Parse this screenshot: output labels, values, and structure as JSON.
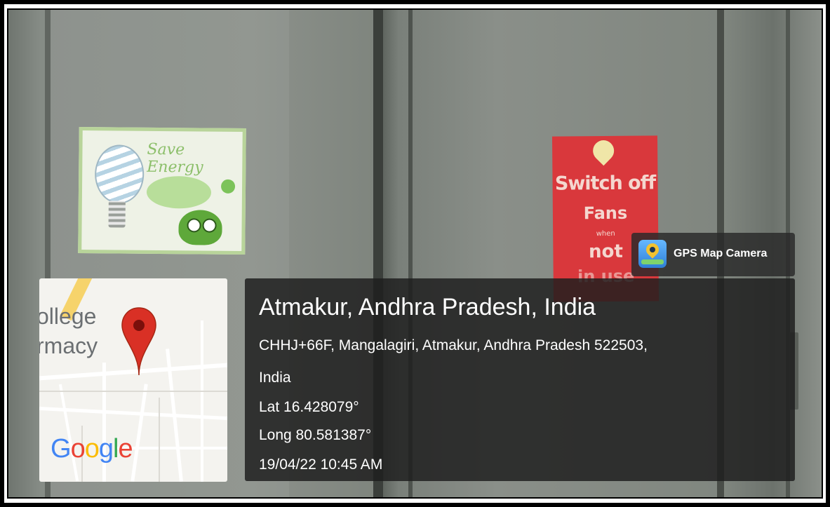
{
  "overlay": {
    "badge_label": "GPS Map Camera",
    "location_title": "Atmakur, Andhra Pradesh, India",
    "address_line1": "CHHJ+66F, Mangalagiri, Atmakur, Andhra Pradesh 522503,",
    "address_line2": "India",
    "latitude": "Lat 16.428079°",
    "longitude": "Long 80.581387°",
    "timestamp": "19/04/22 10:45 AM"
  },
  "map": {
    "label_line1": "ollege",
    "label_line2": "rmacy",
    "logo": {
      "g1": "G",
      "o1": "o",
      "o2": "o",
      "g2": "g",
      "l": "l",
      "e": "e"
    }
  },
  "posters": {
    "save_energy_title": "Save Energy",
    "red_line1": "Switch off",
    "red_line2": "Fans",
    "red_line3": "when",
    "red_line4": "not",
    "red_line5": "in use"
  },
  "colors": {
    "map_pin": "#d93025",
    "panel_bg": "#1e1e1e",
    "red_poster": "#d9383c"
  }
}
